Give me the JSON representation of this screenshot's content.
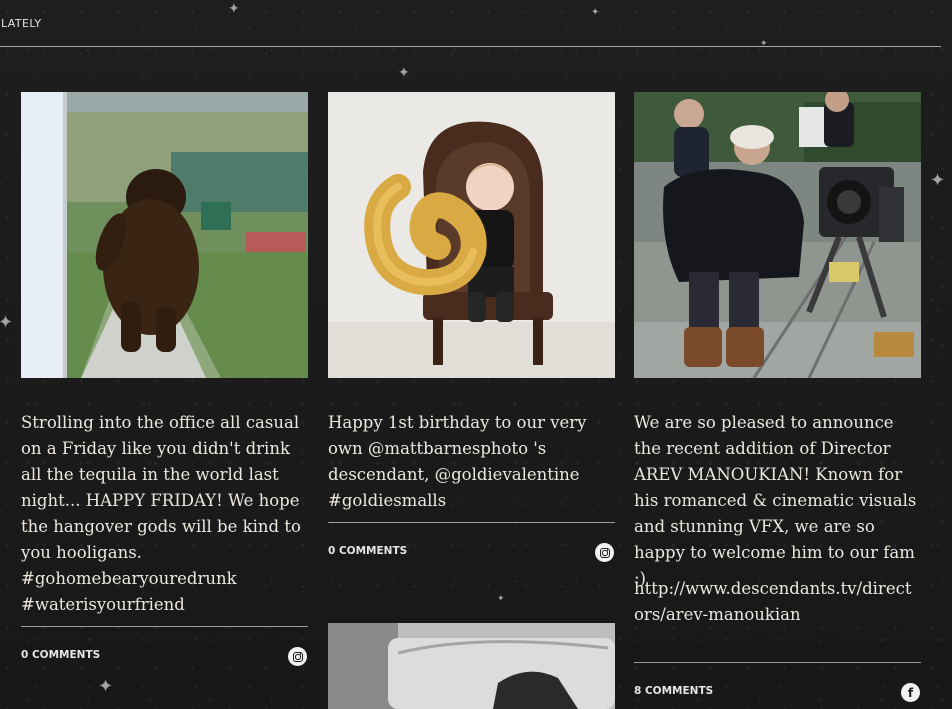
{
  "section": {
    "title": "LATELY"
  },
  "posts": [
    {
      "caption": "Strolling into the office all casual on a Friday like you didn't drink all the tequila in the world last night... HAPPY FRIDAY! We hope the hangover gods will be kind to you hooligans. #gohomebearyouredrunk #waterisyourfriend",
      "comments": "0 COMMENTS",
      "source_icon": "instagram-icon"
    },
    {
      "caption": "Happy 1st birthday to our very own @mattbarnesphoto 's descendant, @goldievalentine #goldiesmalls",
      "comments": "0 COMMENTS",
      "source_icon": "instagram-icon"
    },
    {
      "caption": "We are so pleased to announce the recent addition of Director AREV MANOUKIAN! Known for his romanced & cinematic visuals and stunning VFX, we are so happy to welcome him to our fam :)",
      "link": "http://www.descendants.tv/directors/arev-manoukian",
      "comments": "8 COMMENTS",
      "source_icon": "facebook-icon",
      "source_glyph": "f"
    }
  ],
  "colors": {
    "background": "#1b1b1b",
    "text": "#ece8df",
    "rule": "#9a9a9a"
  }
}
